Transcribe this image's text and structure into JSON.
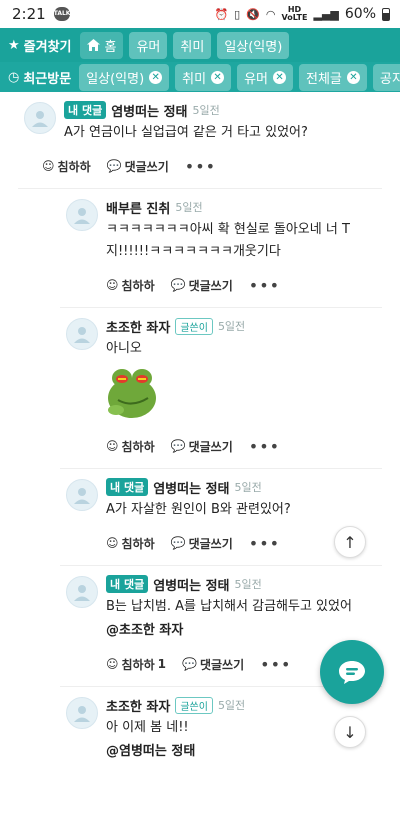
{
  "status_bar": {
    "time": "2:21",
    "battery": "60%"
  },
  "favorites_bar": {
    "title": "즐겨찾기",
    "chips": [
      "홈",
      "유머",
      "취미",
      "일상(익명)"
    ]
  },
  "recent_bar": {
    "title": "최근방문",
    "chips": [
      "일상(익명)",
      "취미",
      "유머",
      "전체글",
      "공지"
    ]
  },
  "actions": {
    "like": "침하하",
    "reply": "댓글쓰기"
  },
  "comments": [
    {
      "badge": "내 댓글",
      "nick": "염병떠는 정태",
      "date": "5일전",
      "text": "A가 연금이나 실업급여 같은 거 타고 있었어?"
    },
    {
      "nick": "배부른 진취",
      "date": "5일전",
      "text": "ㅋㅋㅋㅋㅋㅋㅋ아씨 확 현실로 돌아오네 너 T지!!!!!!ㅋㅋㅋㅋㅋㅋㅋ개웃기다"
    },
    {
      "nick": "초조한 좌자",
      "writer": "글쓴이",
      "date": "5일전",
      "text": "아니오"
    },
    {
      "badge": "내 댓글",
      "nick": "염병떠는 정태",
      "date": "5일전",
      "text": "A가 자살한 원인이 B와 관련있어?"
    },
    {
      "badge": "내 댓글",
      "nick": "염병떠는 정태",
      "date": "5일전",
      "text": "B는 납치범. A를 납치해서 감금해두고 있었어",
      "mention": "@초조한 좌자",
      "like_count": "1"
    },
    {
      "nick": "초조한 좌자",
      "writer": "글쓴이",
      "date": "5일전",
      "text": "아 이제 봄 네!!",
      "mention": "@염병떠는 정태"
    }
  ]
}
